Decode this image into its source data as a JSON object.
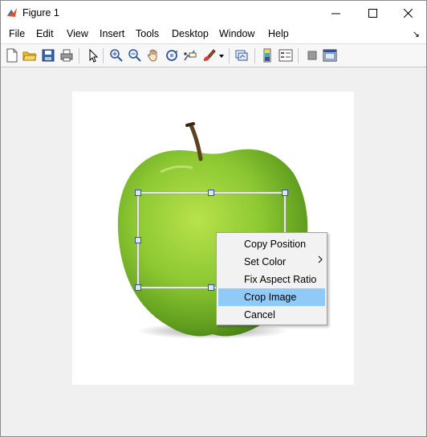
{
  "window": {
    "title": "Figure 1"
  },
  "menu": {
    "items": [
      "File",
      "Edit",
      "View",
      "Insert",
      "Tools",
      "Desktop",
      "Window",
      "Help"
    ],
    "dock_arrow": "↘"
  },
  "toolbar": {
    "icons": [
      "new-figure-icon",
      "open-file-icon",
      "save-icon",
      "print-icon",
      "edit-plot-arrow-icon",
      "zoom-in-icon",
      "zoom-out-icon",
      "pan-hand-icon",
      "rotate-3d-icon",
      "data-cursor-icon",
      "brush-icon",
      "link-plot-icon",
      "insert-colorbar-icon",
      "insert-legend-icon",
      "hide-plot-tools-icon",
      "show-plot-tools-icon"
    ]
  },
  "context_menu": {
    "items": [
      {
        "label": "Copy Position",
        "has_submenu": false,
        "highlighted": false
      },
      {
        "label": "Set Color",
        "has_submenu": true,
        "highlighted": false
      },
      {
        "label": "Fix Aspect Ratio",
        "has_submenu": false,
        "highlighted": false
      },
      {
        "label": "Crop Image",
        "has_submenu": false,
        "highlighted": true
      },
      {
        "label": "Cancel",
        "has_submenu": false,
        "highlighted": false
      }
    ]
  },
  "image": {
    "subject": "green-apple"
  },
  "colors": {
    "highlight": "#91c9f7",
    "apple": "#7fbf2a",
    "handle": "#2f5597"
  }
}
